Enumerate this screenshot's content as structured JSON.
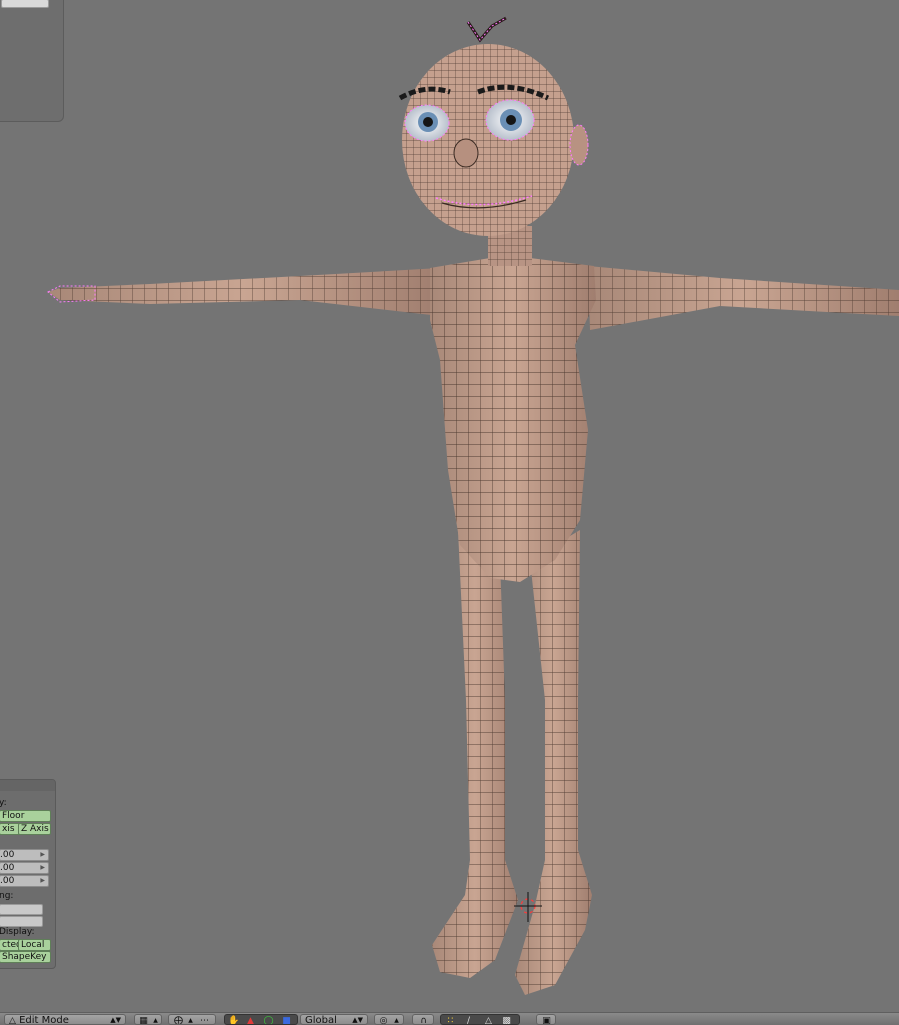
{
  "header": {
    "mode_label": "Edit Mode",
    "orientation_label": "Global"
  },
  "tool_panel": {
    "section_label": "y:",
    "floor_button": "Floor",
    "y_axis_button": "xis",
    "z_axis_button": "Z Axis",
    "values": [
      ".00",
      ".00",
      ".00"
    ],
    "spacing_label": "ng:",
    "display_label": "Display:",
    "display_buttons": [
      "cted",
      "Local"
    ],
    "shapekey_button": "ShapeKey"
  },
  "colors": {
    "background": "#747474",
    "mesh_skin": "#c2a08e",
    "mesh_wire": "#2b1f1a",
    "selected_vertex": "#ff7bff",
    "toggle_green": "#a9d19c"
  },
  "icons": {
    "mode": "edit-mode-icon",
    "shading": "viewport-shading-icon",
    "pivot": "pivot-icon",
    "manipulator_hand": "hand-icon",
    "translate": "translate-icon",
    "rotate": "rotate-icon",
    "scale": "scale-icon",
    "proportional": "proportional-edit-icon",
    "snap": "snap-magnet-icon",
    "select_vertex": "vertex-select-icon",
    "select_edge": "edge-select-icon",
    "select_face": "face-select-icon",
    "occlude": "occlude-geometry-icon",
    "render": "render-preview-icon"
  }
}
